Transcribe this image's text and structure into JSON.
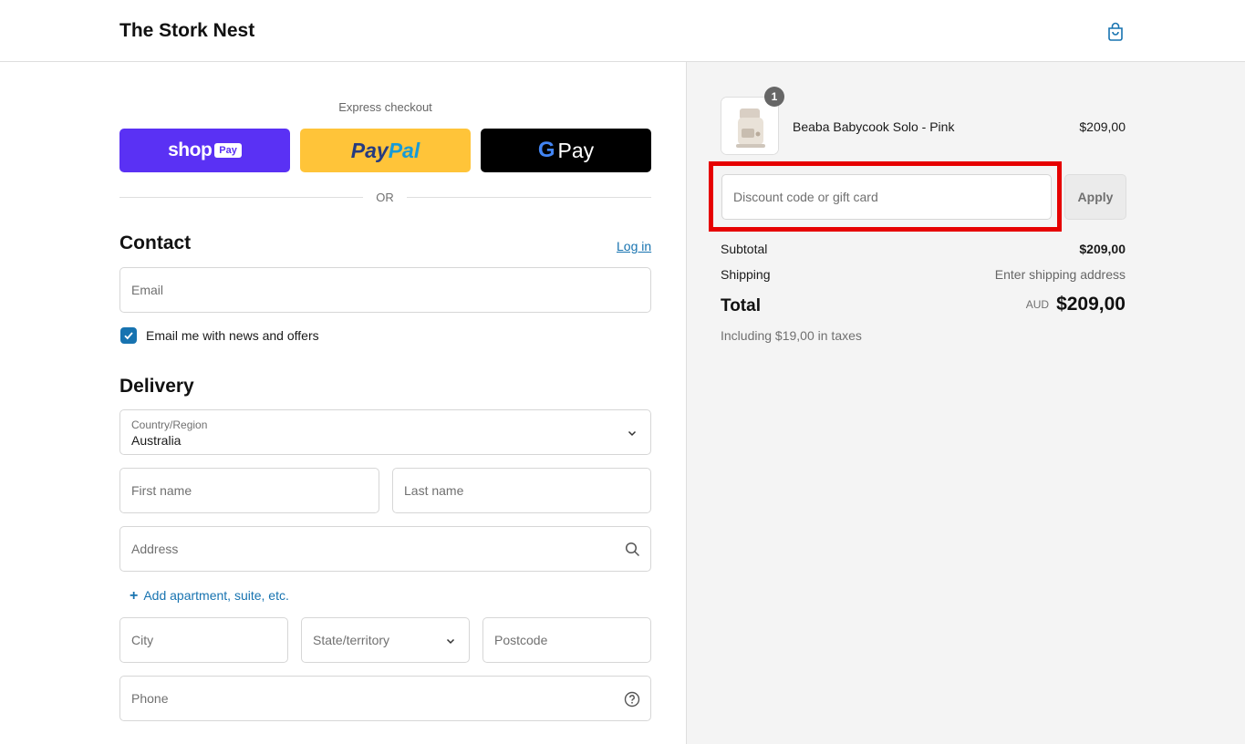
{
  "header": {
    "store_name": "The Stork Nest",
    "cart_icon": "shopping-bag-icon"
  },
  "express": {
    "label": "Express checkout",
    "shop_pay": {
      "text": "shop",
      "badge": "Pay"
    },
    "paypal": {
      "pay": "Pay",
      "pal": "Pal"
    },
    "gpay": {
      "g": "G",
      "pay": "Pay"
    },
    "or": "OR"
  },
  "contact": {
    "title": "Contact",
    "login": "Log in",
    "email_placeholder": "Email",
    "newsletter_label": "Email me with news and offers",
    "newsletter_checked": true
  },
  "delivery": {
    "title": "Delivery",
    "country_label": "Country/Region",
    "country_value": "Australia",
    "first_name": "First name",
    "last_name": "Last name",
    "address": "Address",
    "add_apartment": "Add apartment, suite, etc.",
    "city": "City",
    "state": "State/territory",
    "postcode": "Postcode",
    "phone": "Phone"
  },
  "order": {
    "item": {
      "quantity": "1",
      "name": "Beaba Babycook Solo - Pink",
      "price": "$209,00"
    },
    "discount_placeholder": "Discount code or gift card",
    "apply": "Apply",
    "subtotal_label": "Subtotal",
    "subtotal_value": "$209,00",
    "shipping_label": "Shipping",
    "shipping_value": "Enter shipping address",
    "total_label": "Total",
    "currency": "AUD",
    "total_value": "$209,00",
    "taxes": "Including $19,00 in taxes"
  },
  "colors": {
    "accent": "#1773b0",
    "shop_pay": "#5a31f4",
    "paypal": "#ffc439",
    "highlight": "#e60000"
  }
}
